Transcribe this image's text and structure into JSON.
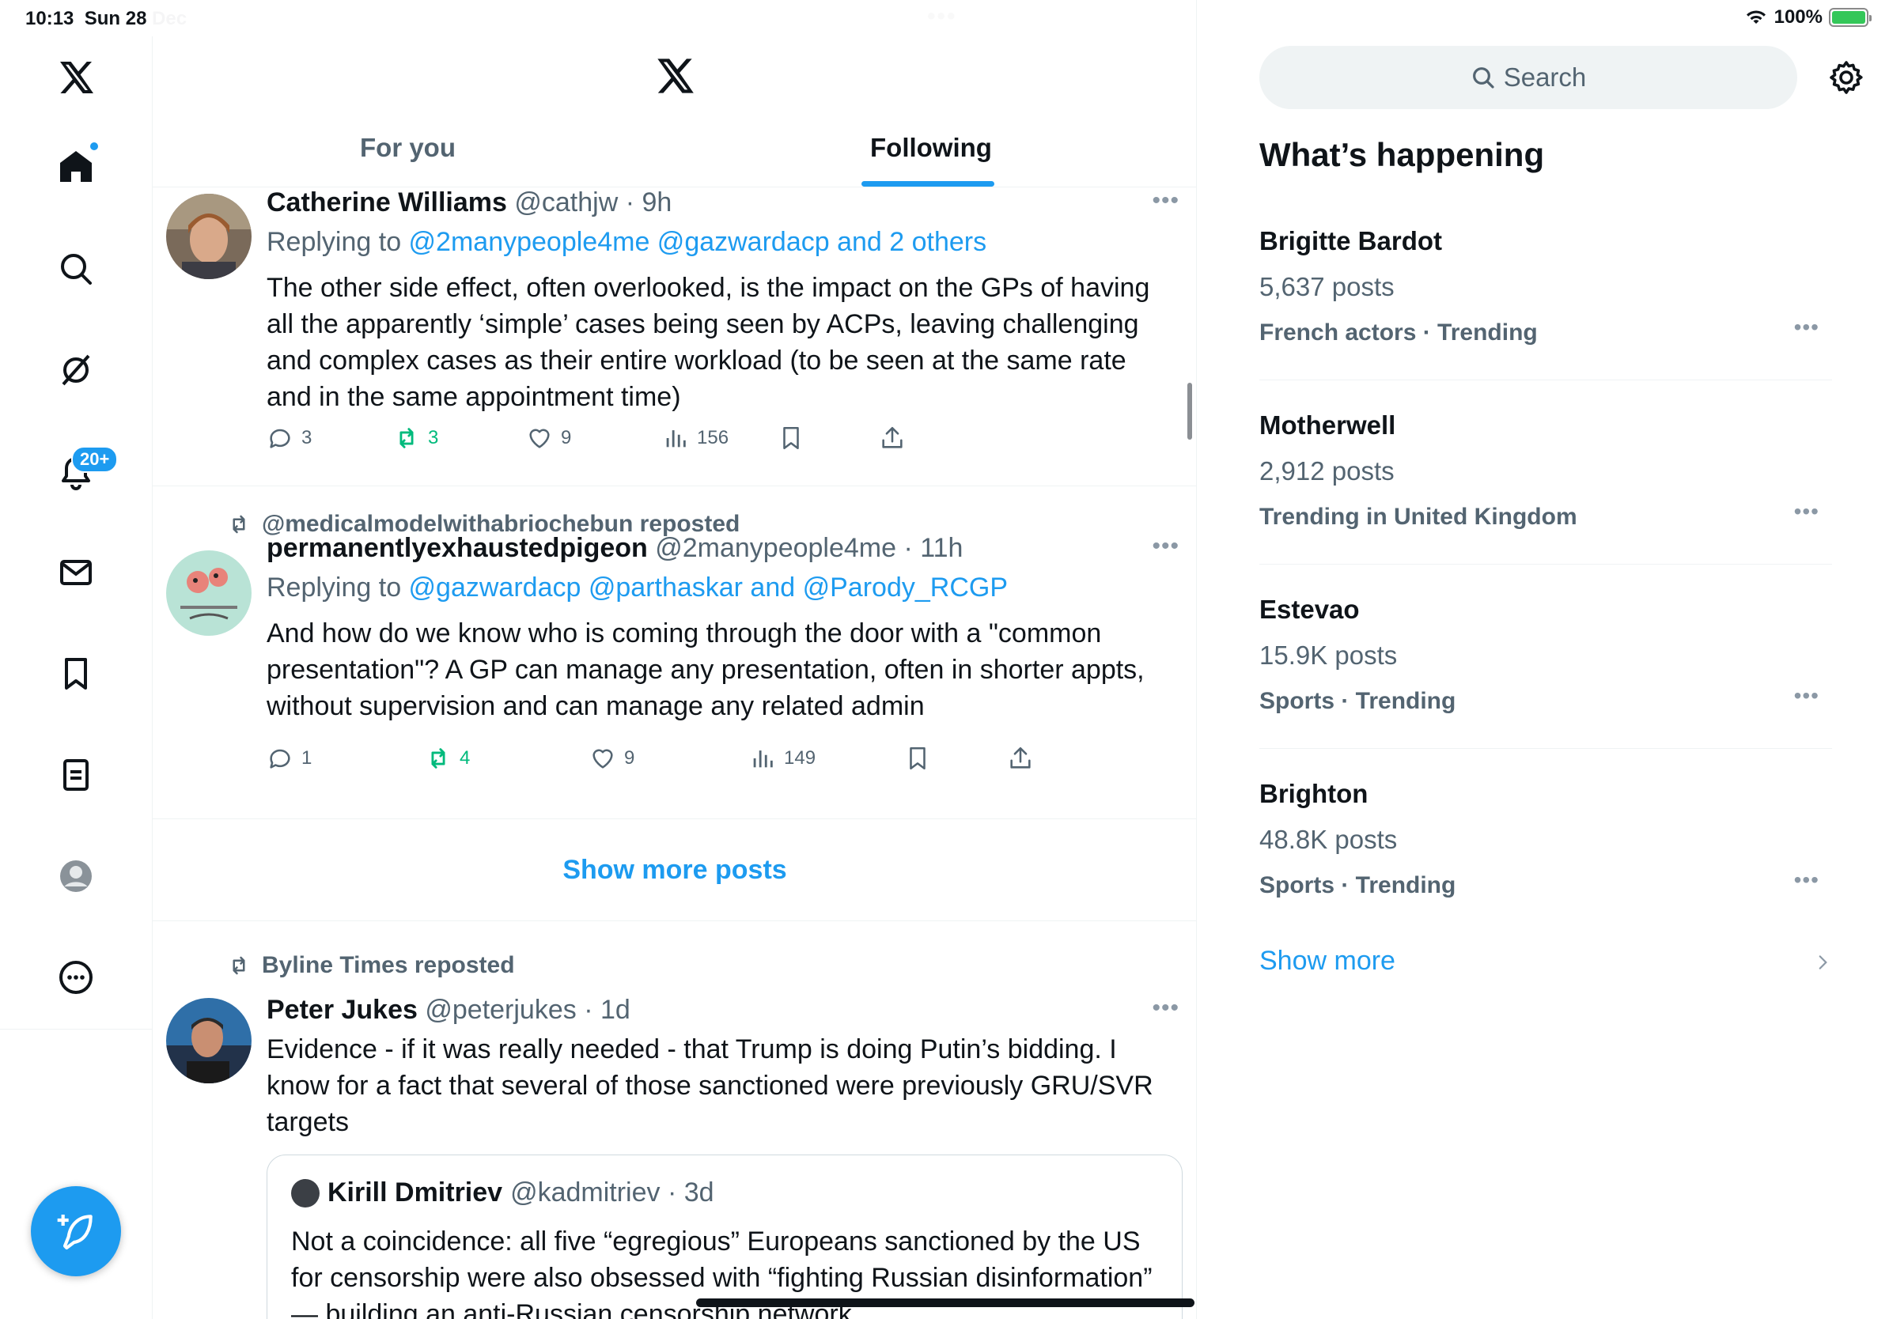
{
  "status_bar": {
    "time": "10:13",
    "date": "Sun 28 Dec",
    "battery": "100%"
  },
  "nav": {
    "notifications_badge": "20+"
  },
  "header": {
    "tabs": [
      {
        "label": "For you",
        "active": false
      },
      {
        "label": "Following",
        "active": true
      }
    ]
  },
  "posts": [
    {
      "name": "Catherine Williams",
      "handle": "@cathjw · 9h",
      "replying_prefix": "Replying to ",
      "replying_to": "@2manypeople4me @gazwardacp and 2 others",
      "text": "The other side effect, often overlooked, is the impact on the GPs of having all the  apparently ‘simple’ cases being seen by ACPs, leaving challenging and complex cases as their entire workload (to be seen at the same rate and in the same appointment time)",
      "replies": "3",
      "reposts": "3",
      "likes": "9",
      "views": "156"
    },
    {
      "reposted_by": "@medicalmodelwithabriochebun reposted",
      "name": "permanentlyexhaustedpigeon",
      "handle": "@2manypeople4me · 11h",
      "replying_prefix": "Replying to ",
      "replying_to": "@gazwardacp @parthaskar and @Parody_RCGP",
      "text": "And how do we know who is coming through the door with a \"common presentation\"? A GP can manage any presentation, often in shorter appts, without supervision and can manage any related admin",
      "replies": "1",
      "reposts": "4",
      "likes": "9",
      "views": "149"
    },
    {
      "reposted_by": "Byline Times reposted",
      "name": "Peter Jukes",
      "handle": "@peterjukes · 1d",
      "text": "Evidence - if it was really needed - that Trump is doing Putin’s bidding. I know for a fact that several of those sanctioned were previously GRU/SVR targets",
      "quote": {
        "name": "Kirill Dmitriev",
        "handle": "@kadmitriev · 3d",
        "text": "Not a coincidence: all five “egregious” Europeans sanctioned by the US for censorship were also obsessed with “fighting Russian disinformation” — building an anti-Russian censorship network"
      }
    }
  ],
  "show_more_posts": "Show more posts",
  "sidebar": {
    "search_placeholder": "Search",
    "title": "What’s happening",
    "trends": [
      {
        "name": "Brigitte Bardot",
        "count": "5,637 posts",
        "category": "French actors · Trending"
      },
      {
        "name": "Motherwell",
        "count": "2,912 posts",
        "category": "Trending in United Kingdom"
      },
      {
        "name": "Estevao",
        "count": "15.9K posts",
        "category": "Sports · Trending"
      },
      {
        "name": "Brighton",
        "count": "48.8K posts",
        "category": "Sports · Trending"
      }
    ],
    "show_more": "Show more"
  },
  "colors": {
    "accent": "#1d9bf0",
    "repost_green": "#00ba7c",
    "secondary_text": "#536471"
  }
}
